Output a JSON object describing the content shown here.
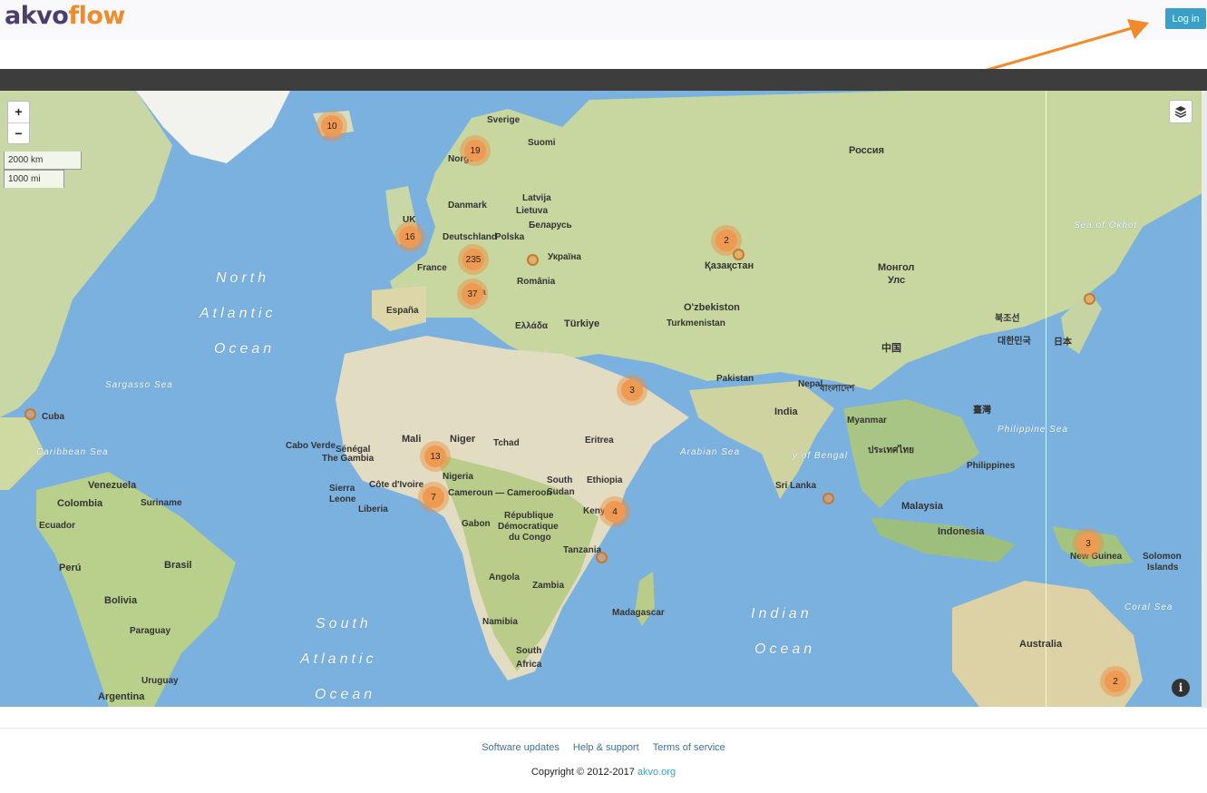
{
  "brand": {
    "part1": "akvo",
    "part2": "flow"
  },
  "header": {
    "login_label": "Log in"
  },
  "map": {
    "zoom_in": "+",
    "zoom_out": "−",
    "scale_km": "2000 km",
    "scale_mi": "1000 mi",
    "info_label": "i",
    "clusters": [
      {
        "count": "10"
      },
      {
        "count": "19"
      },
      {
        "count": "16"
      },
      {
        "count": "235"
      },
      {
        "count": "37"
      },
      {
        "count": "2"
      },
      {
        "count": "3"
      },
      {
        "count": "13"
      },
      {
        "count": "7"
      },
      {
        "count": "4"
      },
      {
        "count": "3"
      },
      {
        "count": "2"
      }
    ],
    "labels": {
      "north_atlantic": [
        "North",
        "Atlantic",
        "Ocean"
      ],
      "south_atlantic": [
        "South",
        "Atlantic",
        "Ocean"
      ],
      "indian": [
        "Indian",
        "Ocean"
      ],
      "sargasso": "Sargasso Sea",
      "caribbean": "Caribbean Sea",
      "arabian": "Arabian Sea",
      "bengal": "y of Bengal",
      "philippine": "Philippine Sea",
      "coral": "Coral Sea",
      "okhotsk": "Sea of Okhot",
      "russia": "Россия",
      "kazakhstan": "Қазақстан",
      "mongolia": [
        "Монгол",
        "Улс"
      ],
      "china": "中国",
      "india": "India",
      "australia": "Australia",
      "indonesia": "Indonesia",
      "malaysia": "Malaysia",
      "brasil": "Brasil",
      "peru": "Perú",
      "bolivia": "Bolivia",
      "argentina": "Argentina",
      "colombia": "Colombia",
      "venezuela": "Venezuela",
      "mali": "Mali",
      "niger": "Niger",
      "turkiye": "Türkiye",
      "uzbekistan": "O'zbekiston",
      "turkmenistan": "Turkmenistan",
      "pakistan": "Pakistan",
      "nepal": "Nepal",
      "myanmar": "Myanmar",
      "philippines": "Philippines",
      "sverige": "Sverige",
      "suomi": "Suomi",
      "norge": "Norge",
      "uk": "UK",
      "france": "France",
      "espana": "España",
      "deutschland": "Deutschland",
      "polska": "Polska",
      "ukraina": "Україна",
      "kenya": "Kenya",
      "tanzania": "Tanzania",
      "angola": "Angola",
      "zambia": "Zambia",
      "namibia": "Namibia",
      "south_africa": [
        "South",
        "Africa"
      ],
      "madagascar": "Madagascar",
      "ethiopia": "Ethiopia",
      "nigeria": "Nigeria",
      "cameroon": "Cameroun — Cameroon",
      "gabon": "Gabon",
      "rdc": [
        "République",
        "Démocratique",
        "du Congo"
      ],
      "sri_lanka": "Sri Lanka",
      "new_guinea": "New Guinea",
      "solomon": [
        "Solomon",
        "Islands"
      ],
      "paraguay": "Paraguay",
      "uruguay": "Uruguay",
      "ecuador": "Ecuador",
      "suriname": "Suriname",
      "cuba": "Cuba",
      "senegal": "Sénégal",
      "the_gambia": "The Gambia",
      "cabo_verde": "Cabo Verde",
      "sierra_leone": [
        "Sierra",
        "Leone"
      ],
      "liberia": "Liberia",
      "cote_divoire": "Côte d'Ivoire",
      "tchad": "Tchad",
      "eritrea": "Eritrea",
      "south_sudan": [
        "South",
        "Sudan"
      ],
      "danmark": "Danmark",
      "latvija": "Latvija",
      "lietuva": "Lietuva",
      "belarus": "Беларусь",
      "romania": "România",
      "italia": "Italia",
      "ellada": "Ελλάδα",
      "japan": "日本",
      "korea": "대한민국",
      "nk": "북조선",
      "taiwan": "臺灣",
      "bangladesh": "বাংলাদেশ",
      "thailand": "ประเทศไทย"
    }
  },
  "footer": {
    "links": [
      "Software updates",
      "Help & support",
      "Terms of service"
    ],
    "copyright": "Copyright © 2012-2017",
    "copyright_link": "akvo.org"
  }
}
